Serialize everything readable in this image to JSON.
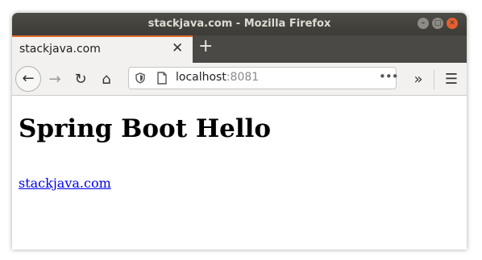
{
  "window": {
    "title": "stackjava.com - Mozilla Firefox"
  },
  "tabs": [
    {
      "label": "stackjava.com",
      "close_glyph": "✕"
    }
  ],
  "newtab_glyph": "+",
  "navbar": {
    "back_glyph": "←",
    "forward_glyph": "→",
    "reload_glyph": "↻",
    "home_glyph": "⌂",
    "overflow_glyph": "»",
    "menu_glyph": "☰"
  },
  "urlbar": {
    "host": "localhost",
    "port": ":8081",
    "more_glyph": "•••"
  },
  "page": {
    "heading": "Spring Boot Hello",
    "link_text": "stackjava.com"
  },
  "colors": {
    "titlebar": "#3c3b37",
    "tab_accent": "#e56d30",
    "link": "#0000ee",
    "close_button": "#e4602f"
  },
  "icons": [
    "minimize-icon",
    "maximize-icon",
    "close-icon",
    "back-arrow-icon",
    "forward-arrow-icon",
    "reload-icon",
    "home-icon",
    "shield-icon",
    "page-icon",
    "more-icon",
    "overflow-icon",
    "hamburger-menu-icon",
    "new-tab-icon"
  ]
}
